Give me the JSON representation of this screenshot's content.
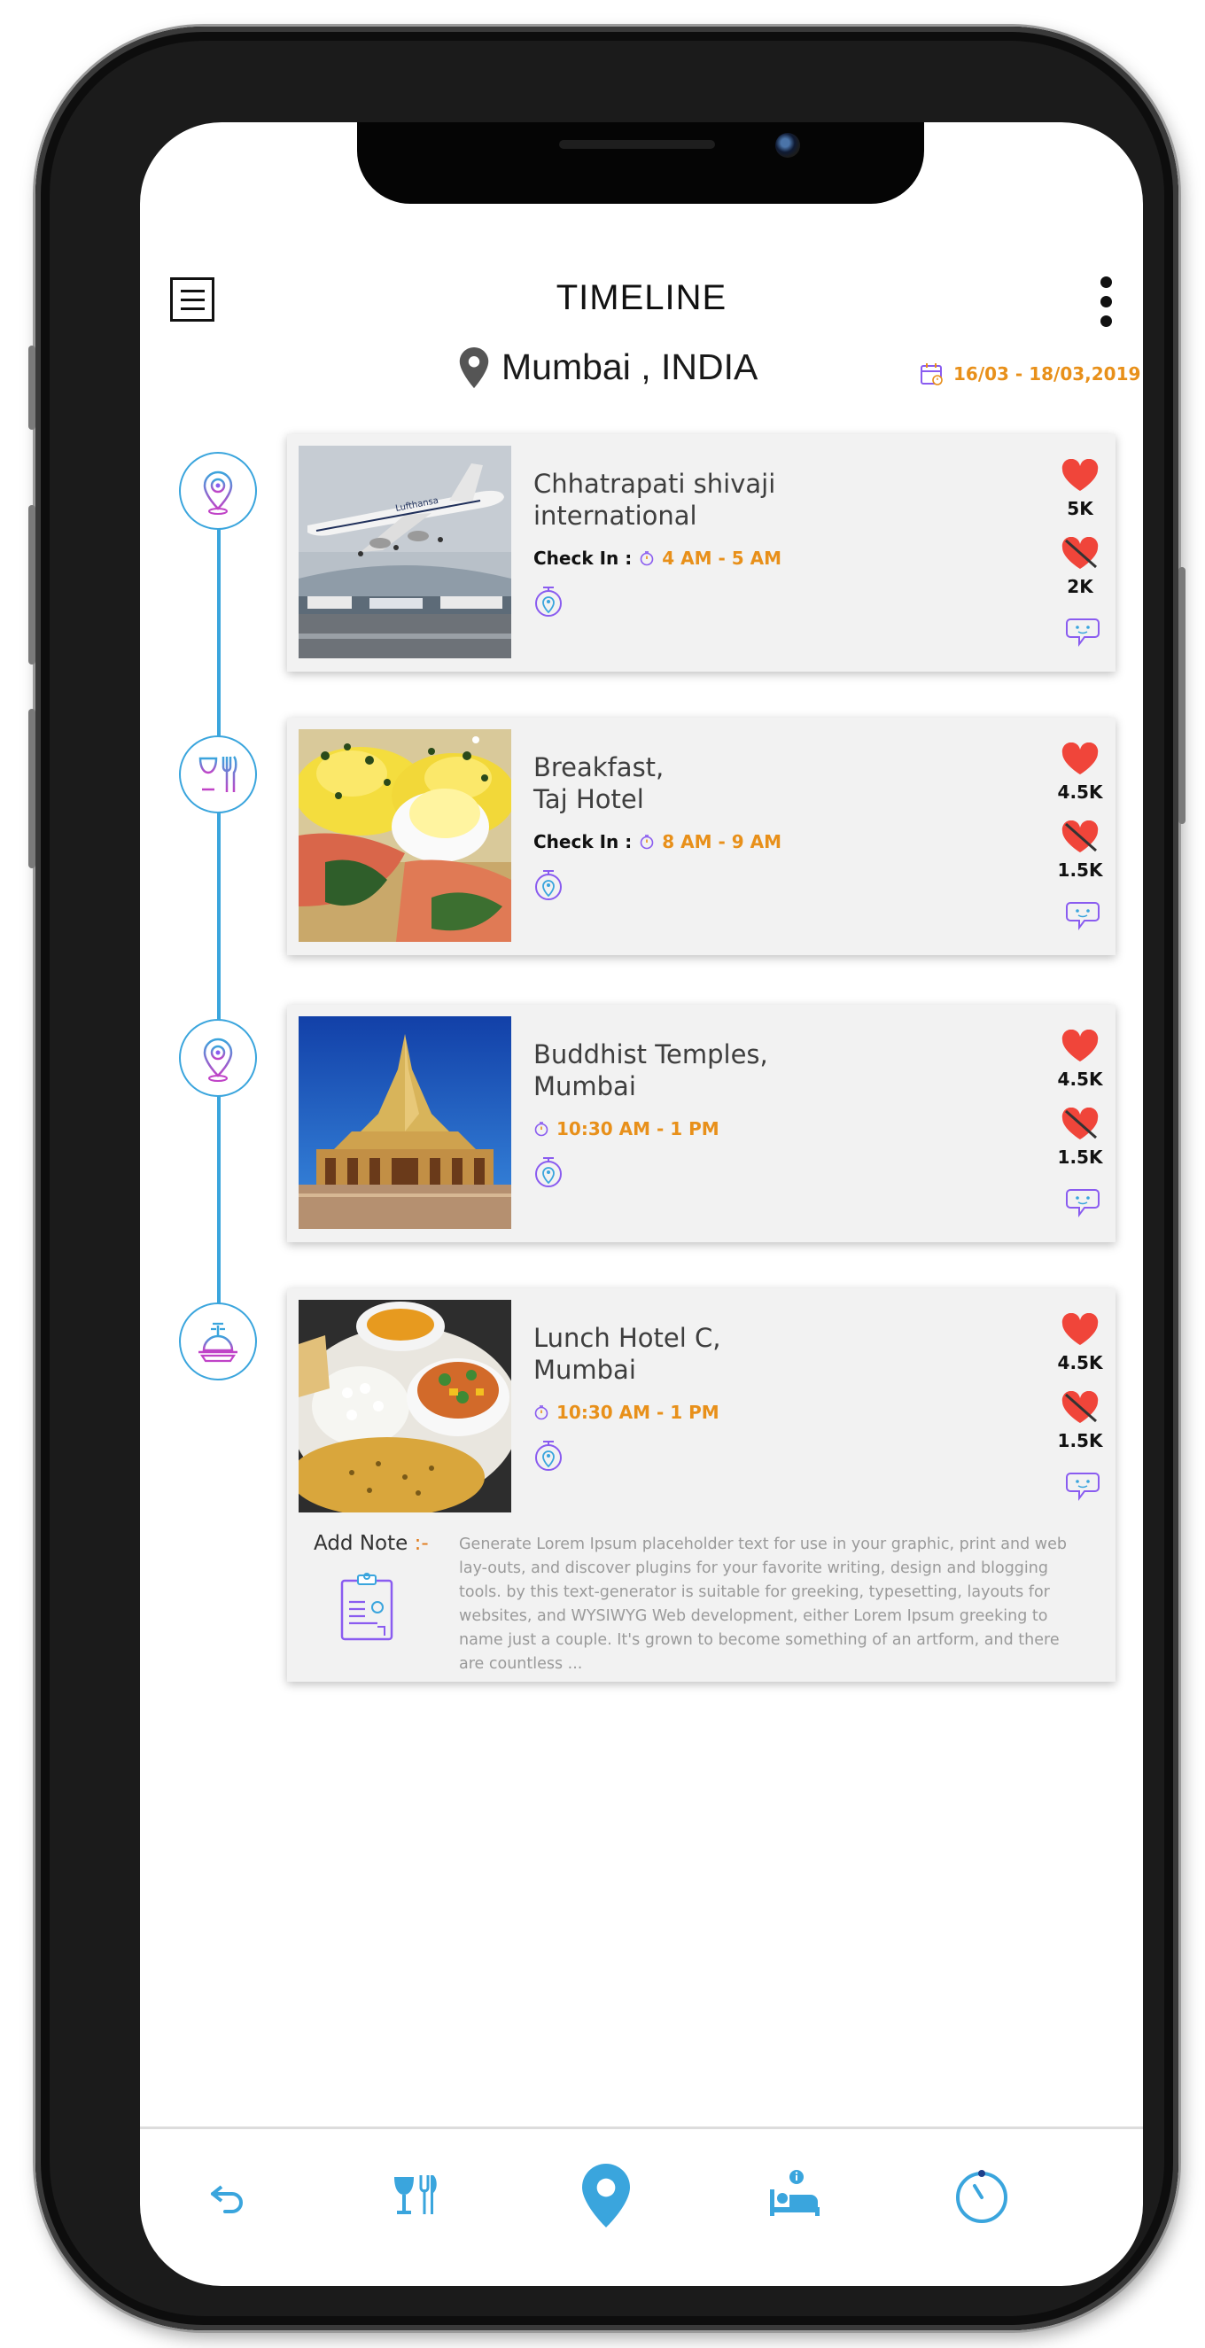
{
  "header": {
    "title": "TIMELINE",
    "menu_icon": "hamburger-menu-icon",
    "more_icon": "more-vertical-icon"
  },
  "location": {
    "text": "Mumbai , INDIA",
    "icon": "location-pin-icon"
  },
  "date_range": {
    "text": "16/03 - 18/03,2019",
    "icon": "calendar-icon"
  },
  "colors": {
    "accent_blue": "#3aa5dd",
    "orange": "#e8901a",
    "purple": "#8a5cf0",
    "heart_red": "#f0453a",
    "card_bg": "#f2f2f2"
  },
  "items": [
    {
      "title": "Chhatrapati shivaji\ninternational",
      "checkin_label": "Check In :",
      "time": "4 AM - 5 AM",
      "likes": "5K",
      "dislikes": "2K",
      "node_icon": "location-pin-icon",
      "photo": "airplane-photo"
    },
    {
      "title": "Breakfast,\nTaj Hotel",
      "checkin_label": "Check In :",
      "time": "8 AM - 9 AM",
      "likes": "4.5K",
      "dislikes": "1.5K",
      "node_icon": "restaurant-icon",
      "photo": "breakfast-photo"
    },
    {
      "title": "Buddhist Temples,\nMumbai",
      "time": "10:30 AM - 1 PM",
      "likes": "4.5K",
      "dislikes": "1.5K",
      "node_icon": "location-pin-icon",
      "photo": "temple-photo"
    },
    {
      "title": "Lunch Hotel C,\nMumbai",
      "time": "10:30 AM - 1 PM",
      "likes": "4.5K",
      "dislikes": "1.5K",
      "node_icon": "serving-dish-icon",
      "photo": "lunch-photo"
    }
  ],
  "note": {
    "label": "Add Note",
    "separator": " :-",
    "text": "Generate Lorem Ipsum placeholder text for use in your graphic, print and web lay-outs, and discover plugins for your favorite writing, design and blogging tools. by this text-generator is suitable for greeking, typesetting, layouts for websites, and WYSIWYG Web development, either Lorem Ipsum greeking to name just a couple. It's grown to become something of an artform, and there are countless ..."
  },
  "tabbar": [
    {
      "icon": "back-arrow-icon"
    },
    {
      "icon": "food-drink-icon"
    },
    {
      "icon": "location-pin-icon"
    },
    {
      "icon": "hotel-bed-icon"
    },
    {
      "icon": "timer-icon"
    }
  ]
}
